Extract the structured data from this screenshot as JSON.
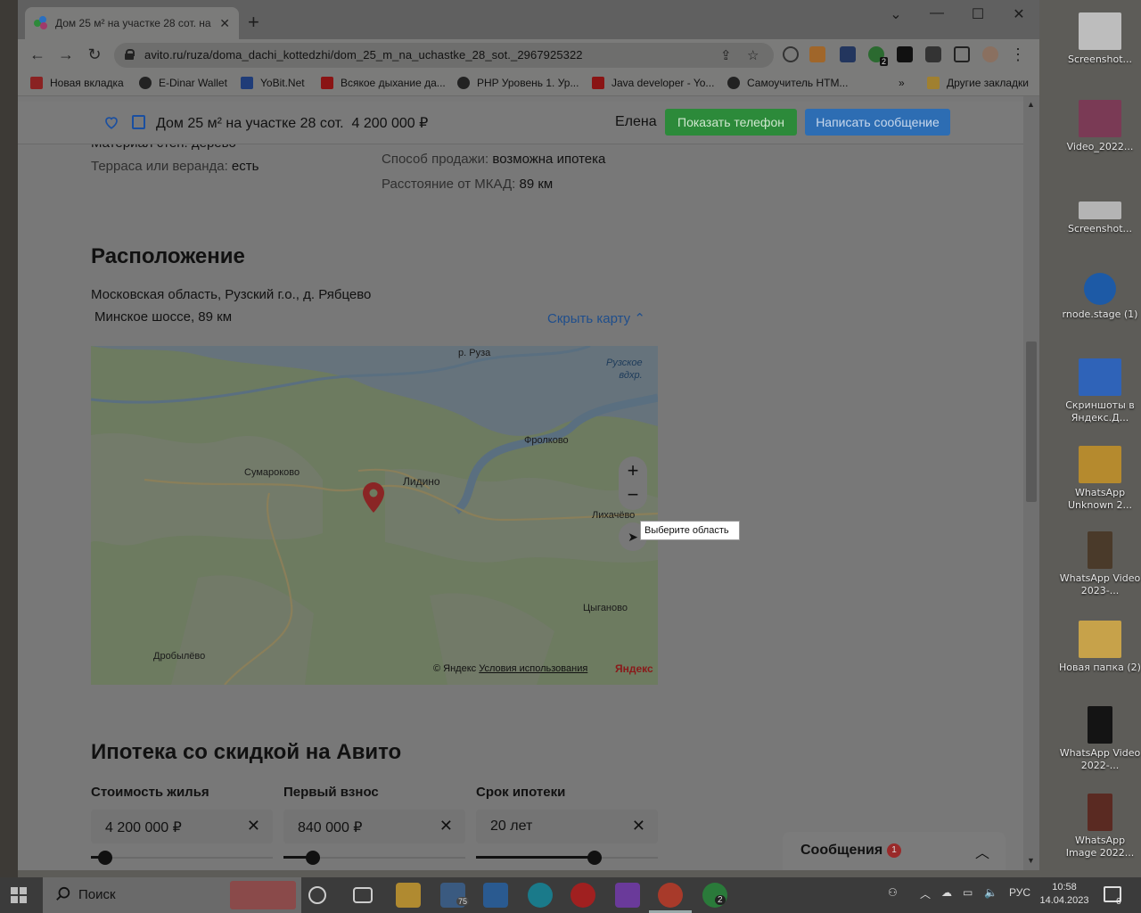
{
  "browser": {
    "tab_title": "Дом 25 м² на участке 28 сот. на",
    "url": "avito.ru/ruza/doma_dachi_kottedzhi/dom_25_m_na_uchastke_28_sot._2967925322",
    "bookmarks": [
      {
        "label": "Новая вкладка",
        "color": "#a02828"
      },
      {
        "label": "E-Dinar Wallet",
        "color": "#222222"
      },
      {
        "label": "YoBit.Net",
        "color": "#1f3c78"
      },
      {
        "label": "Всякое дыхание да...",
        "color": "#9a1b1b"
      },
      {
        "label": "PHP Уровень 1. Ур...",
        "color": "#222222"
      },
      {
        "label": "Java developer - Yo...",
        "color": "#9a1b1b"
      },
      {
        "label": "Самоучитель HTM...",
        "color": "#222222"
      }
    ],
    "bookmarks_more": "»",
    "other_bookmarks": "Другие закладки",
    "window_controls": {
      "minimize": "—",
      "maximize": "☐",
      "close": "✕",
      "tab_menu": "⌄"
    }
  },
  "sticky": {
    "title": "Дом 25 м² на участке 28 сот.",
    "price": "4 200 000 ₽",
    "seller": "Елена",
    "phone_button": "Показать телефон",
    "message_button": "Написать сообщение"
  },
  "properties": {
    "cut_line": "Материал стен: дерево",
    "terrace_key": "Терраса или веранда:",
    "terrace_val": "есть",
    "sale_key": "Способ продажи:",
    "sale_val": "возможна ипотека",
    "distance_key": "Расстояние от МКАД:",
    "distance_val": "89 км"
  },
  "location": {
    "heading": "Расположение",
    "address": "Московская область, Рузский г.о., д. Рябцево",
    "highway": "Минское шоссе, 89 км",
    "hide_map": "Скрыть карту",
    "map_labels": {
      "ruza": "р. Руза",
      "reservoir_1": "Рузское",
      "reservoir_2": "вдхр.",
      "frolkovo": "Фролково",
      "sumarokovo": "Сумароково",
      "lidino": "Лидино",
      "likhachevo": "Лихачёво",
      "tsyganovo": "Цыганово",
      "drobylevo": "Дробылёво"
    },
    "tooltip": "Выберите область",
    "copyright": "© Яндекс",
    "terms": "Условия использования",
    "brand": "Яндекс"
  },
  "mortgage": {
    "heading": "Ипотека со скидкой на Авито",
    "fields": [
      {
        "label": "Стоимость жилья",
        "value": "4 200 000 ₽",
        "slider_fraction": 0.08
      },
      {
        "label": "Первый взнос",
        "value": "840 000 ₽",
        "slider_fraction": 0.16
      },
      {
        "label": "Срок ипотеки",
        "value": "20 лет",
        "slider_fraction": 0.65
      }
    ]
  },
  "messages": {
    "title": "Сообщения",
    "count": "1"
  },
  "desktop": {
    "icons": [
      {
        "label": "Screenshot...",
        "color": "#c9c9c9"
      },
      {
        "label": "Video_2022...",
        "color": "#7a3a55"
      },
      {
        "label": "Screenshot...",
        "color": "#bdbdbd"
      },
      {
        "label": "rnode.stage (1)",
        "color": "#1d5aa6"
      },
      {
        "label": "Скриншоты в Яндекс.Д...",
        "color": "#2f63b8"
      },
      {
        "label": "WhatsApp Unknown 2...",
        "color": "#b58a2e"
      },
      {
        "label": "WhatsApp Video 2023-...",
        "color": "#4a3a2a"
      },
      {
        "label": "Новая папка (2)",
        "color": "#c7a24a"
      },
      {
        "label": "WhatsApp Video 2022-...",
        "color": "#141414"
      },
      {
        "label": "WhatsApp Image 2022...",
        "color": "#5a2a22"
      }
    ]
  },
  "taskbar": {
    "search": "Поиск",
    "mail_badge": "75",
    "whatsapp_badge": "2",
    "lang": "РУС",
    "time": "10:58",
    "date": "14.04.2023",
    "notifications": "6"
  }
}
